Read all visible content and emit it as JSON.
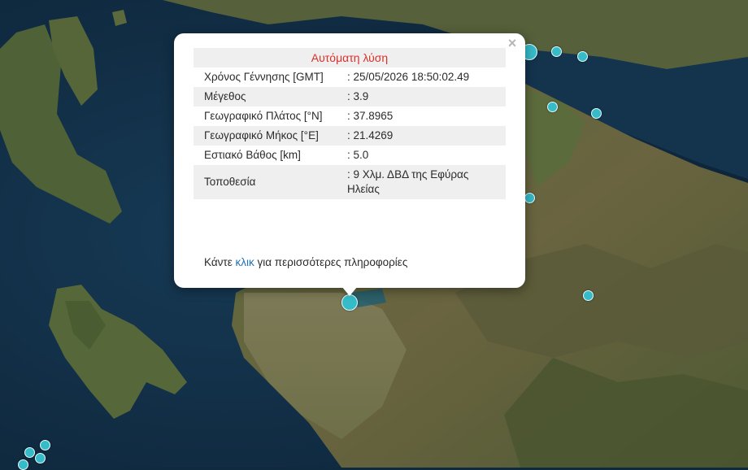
{
  "popup": {
    "title": "Αυτόματη λύση",
    "close_symbol": "×",
    "rows": [
      {
        "label": "Χρόνος Γέννησης [GMT]",
        "value": ": 25/05/2026 18:50:02.49"
      },
      {
        "label": "Μέγεθος",
        "value": ": 3.9"
      },
      {
        "label": "Γεωγραφικό Πλάτος [°N]",
        "value": ": 37.8965"
      },
      {
        "label": "Γεωγραφικό Μήκος [°E]",
        "value": ": 21.4269"
      },
      {
        "label": "Εστιακό Βάθος [km]",
        "value": ": 5.0"
      },
      {
        "label": "Τοποθεσία",
        "value": ": 9 Χλμ. ΔΒΔ της Εφύρας Ηλείας"
      }
    ],
    "footer": {
      "before": "Κάντε ",
      "link": "κλικ",
      "after": " για περισσότερες πληροφορίες"
    }
  },
  "colors": {
    "sea": "#0f2a3f",
    "land": "#4e5a34",
    "marker": "#36bcc9",
    "title_red": "#d9302a",
    "link_blue": "#1f72b6"
  },
  "map": {
    "marker_icon": "earthquake-circle-icon",
    "selected_epicenter": "37.8965, 21.4269"
  }
}
